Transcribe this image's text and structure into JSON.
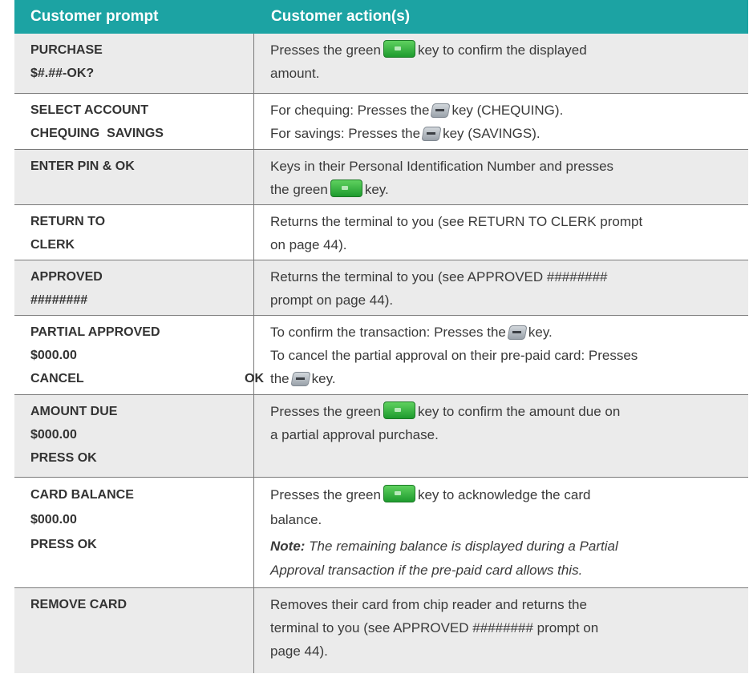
{
  "header": {
    "col1": "Customer prompt",
    "col2": "Customer action(s)"
  },
  "rows": [
    {
      "prompt": [
        "PURCHASE",
        "$#.##-OK?"
      ],
      "a1_pre": "Presses the green",
      "a1_post": "key to confirm the displayed",
      "a2": "amount."
    },
    {
      "prompt": [
        "SELECT ACCOUNT",
        "CHEQUING  SAVINGS"
      ],
      "a1_pre": "For chequing: Presses the",
      "a1_post": "key (CHEQUING).",
      "a2_pre": "For savings: Presses the",
      "a2_post": "key (SAVINGS)."
    },
    {
      "prompt": [
        "ENTER PIN & OK"
      ],
      "a1": "Keys in their Personal Identification Number and presses",
      "a2_pre": "the green",
      "a2_post": "key."
    },
    {
      "prompt": [
        "RETURN TO",
        "CLERK"
      ],
      "a1": "Returns the terminal to you (see RETURN TO CLERK prompt",
      "a2": "on page 44)."
    },
    {
      "prompt": [
        "APPROVED",
        "########"
      ],
      "a1": "Returns the terminal to you (see APPROVED ########",
      "a2": "prompt on page 44)."
    },
    {
      "prompt": [
        "PARTIAL APPROVED",
        "$000.00",
        "CANCEL"
      ],
      "prompt_ok": "OK",
      "a1_pre": "To confirm the transaction: Presses the",
      "a1_post": "key.",
      "a2": "To cancel the partial approval on their pre-paid card: Presses",
      "a3_pre": "the",
      "a3_post": "key."
    },
    {
      "prompt": [
        "AMOUNT DUE",
        "$000.00",
        "PRESS OK"
      ],
      "a1_pre": "Presses the green",
      "a1_post": "key to confirm the amount due on",
      "a2": "a partial approval purchase."
    },
    {
      "prompt": [
        "CARD BALANCE",
        "$000.00",
        "PRESS OK"
      ],
      "a1_pre": "Presses the green",
      "a1_post": "key to acknowledge the card",
      "a2": "balance.",
      "note_label": "Note:",
      "note1": " The remaining balance is displayed during a Partial",
      "note2": "Approval transaction if the pre-paid card allows this."
    },
    {
      "prompt": [
        "REMOVE CARD"
      ],
      "a1": "Removes their card from chip reader and returns the",
      "a2": "terminal to you (see APPROVED ######## prompt on",
      "a3": "page 44)."
    }
  ],
  "icons": {
    "green_key": "green-ok-key-icon",
    "grey_key": "grey-softkey-icon"
  }
}
